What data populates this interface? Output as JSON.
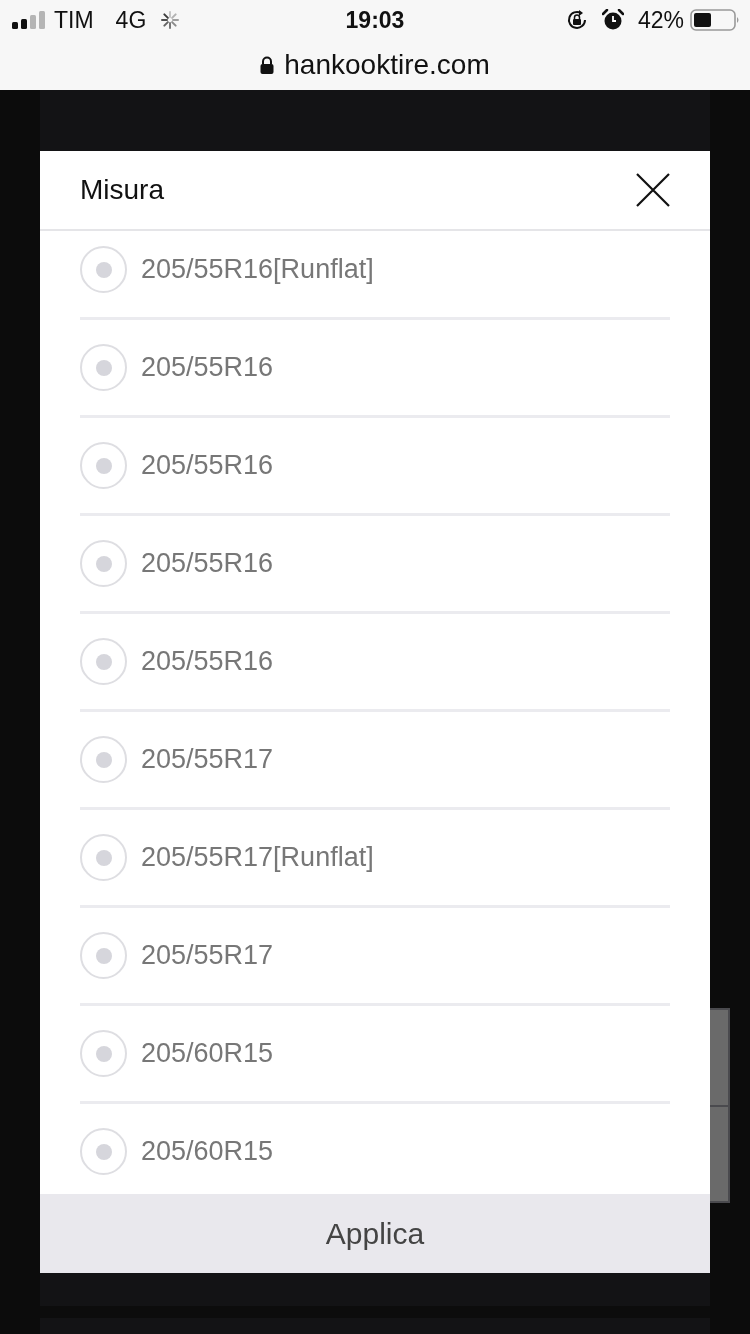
{
  "status_bar": {
    "carrier": "TIM",
    "network": "4G",
    "time": "19:03",
    "battery": "42%"
  },
  "address_bar": {
    "url": "hankooktire.com"
  },
  "dialog": {
    "title": "Misura",
    "options": [
      {
        "label": "205/55R16[Runflat]",
        "selected": false
      },
      {
        "label": "205/55R16",
        "selected": false
      },
      {
        "label": "205/55R16",
        "selected": false
      },
      {
        "label": "205/55R16",
        "selected": false
      },
      {
        "label": "205/55R16",
        "selected": false
      },
      {
        "label": "205/55R17",
        "selected": false
      },
      {
        "label": "205/55R17[Runflat]",
        "selected": false
      },
      {
        "label": "205/55R17",
        "selected": false
      },
      {
        "label": "205/60R15",
        "selected": false
      },
      {
        "label": "205/60R15",
        "selected": false
      }
    ],
    "apply_button": "Applica"
  }
}
